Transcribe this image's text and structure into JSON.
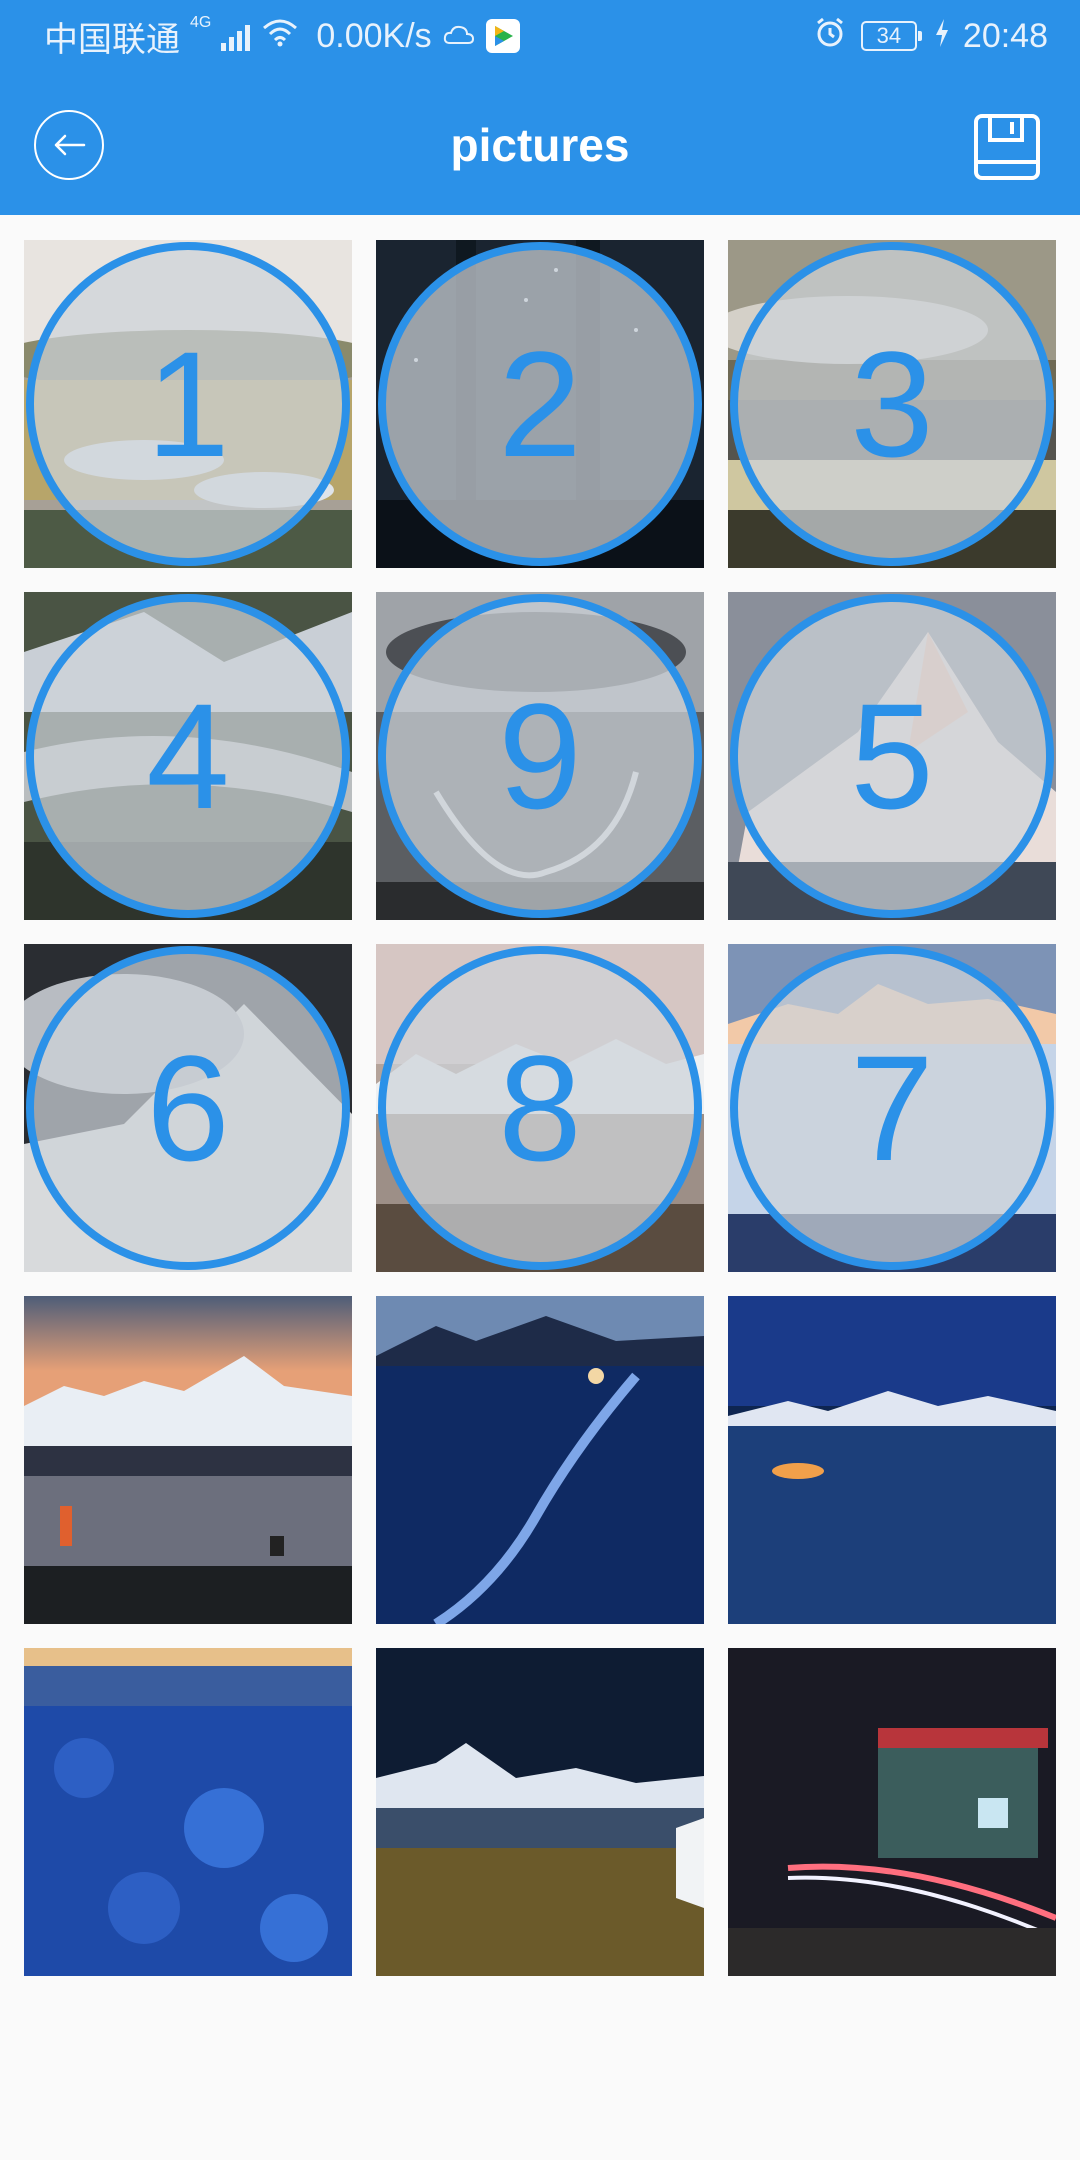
{
  "status_bar": {
    "carrier": "中国联通",
    "network": "4G",
    "speed": "0.00K/s",
    "battery": "34",
    "time": "20:48"
  },
  "app_bar": {
    "title": "pictures",
    "back_icon": "back-arrow-icon",
    "save_icon": "floppy-disk-icon"
  },
  "grid": {
    "cells": [
      {
        "label": "1",
        "scene": "alpine meadow with clouds",
        "selected": true
      },
      {
        "label": "2",
        "scene": "starry forest night",
        "selected": true
      },
      {
        "label": "3",
        "scene": "lake at sunset with clouds",
        "selected": true
      },
      {
        "label": "4",
        "scene": "river through forest",
        "selected": true
      },
      {
        "label": "9",
        "scene": "valley with winding river",
        "selected": true
      },
      {
        "label": "5",
        "scene": "snow peak at sunrise",
        "selected": true
      },
      {
        "label": "6",
        "scene": "misty snow mountain",
        "selected": true
      },
      {
        "label": "8",
        "scene": "snow range over plain",
        "selected": true
      },
      {
        "label": "7",
        "scene": "frozen lake with peaks",
        "selected": true
      },
      {
        "label": "",
        "scene": "photographers at lake",
        "selected": false
      },
      {
        "label": "",
        "scene": "blue frozen lake",
        "selected": false
      },
      {
        "label": "",
        "scene": "night sky over lake",
        "selected": false
      },
      {
        "label": "",
        "scene": "blue ice texture",
        "selected": false
      },
      {
        "label": "",
        "scene": "milky way and tent",
        "selected": false
      },
      {
        "label": "",
        "scene": "temple with light trails",
        "selected": false
      }
    ]
  },
  "colors": {
    "accent": "#2b91e8",
    "background": "#fafafa"
  }
}
